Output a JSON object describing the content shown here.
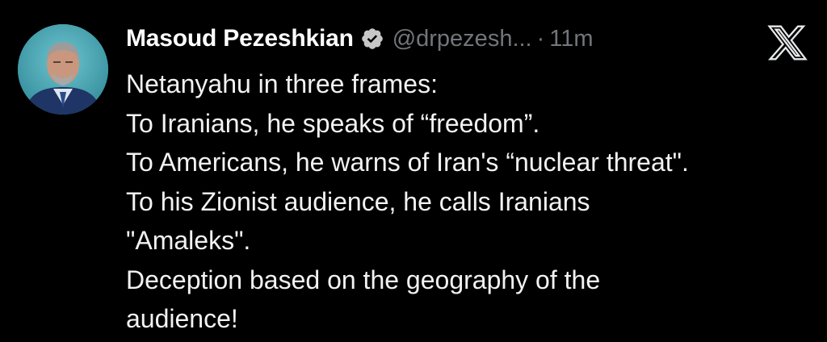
{
  "tweet": {
    "author": {
      "display_name": "Masoud Pezeshkian",
      "handle": "@drpezesh...",
      "verified": true,
      "avatar_icon": "profile-photo"
    },
    "separator": "·",
    "timestamp": "11m",
    "platform_icon": "x-logo-icon",
    "body_lines": [
      "Netanyahu in three frames:",
      "To Iranians, he speaks of “freedom”.",
      "To Americans, he warns of Iran's “nuclear threat\".",
      "To his Zionist audience, he calls Iranians",
      "\"Amaleks\".",
      "Deception based on the geography of the",
      "audience!"
    ]
  },
  "colors": {
    "background": "#000000",
    "name": "#ffffff",
    "muted": "#71767b",
    "text": "#f2f2f2",
    "verified_badge": "#c7c7c7"
  }
}
